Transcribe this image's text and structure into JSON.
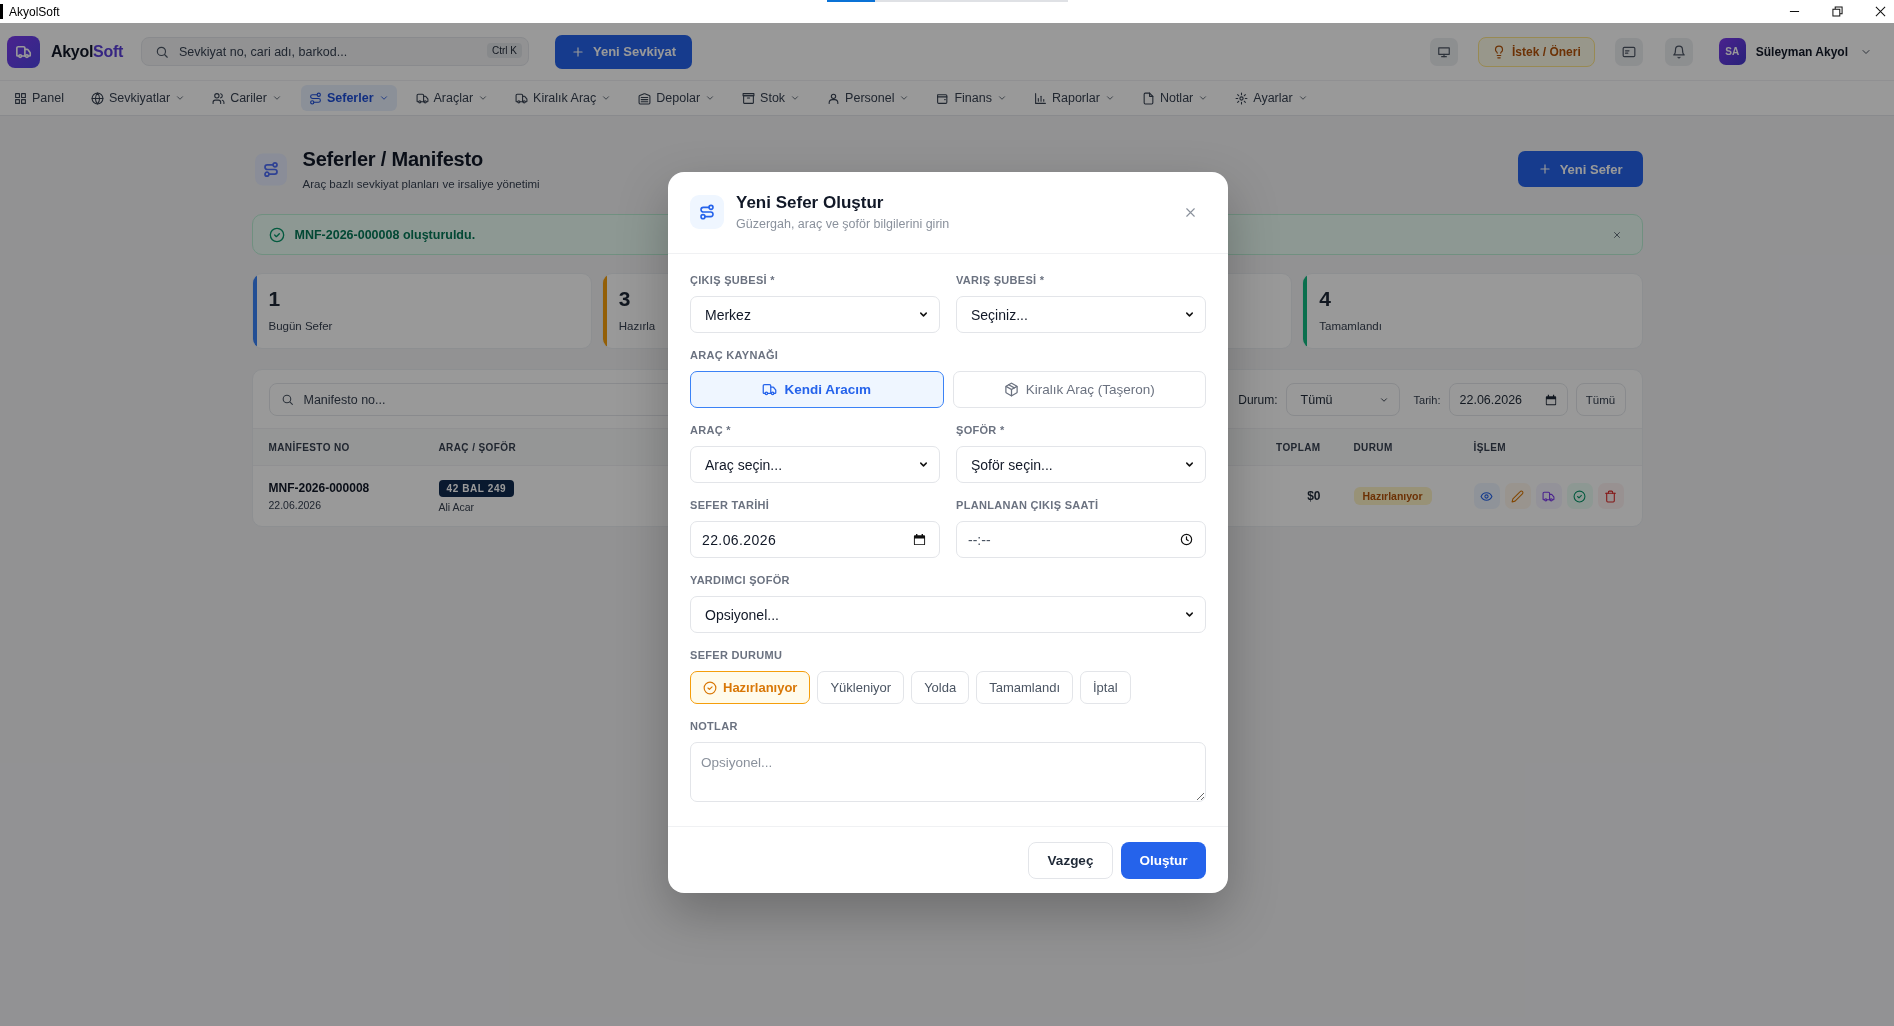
{
  "window": {
    "title": "AkyolSoft",
    "loading": {
      "level": 0.2
    }
  },
  "header": {
    "brand": [
      "Akyol",
      "Soft"
    ],
    "search": {
      "placeholder": "Sevkiyat no, cari adı, barkod...",
      "shortcut": "Ctrl K"
    },
    "new_button": "Yeni Sevkiyat",
    "suggestion_button": "İstek / Öneri",
    "user": {
      "initials": "SA",
      "name": "Süleyman Akyol"
    }
  },
  "nav": [
    {
      "label": "Panel",
      "selected": false,
      "dropdown": false
    },
    {
      "label": "Sevkiyatlar",
      "selected": false,
      "dropdown": true
    },
    {
      "label": "Cariler",
      "selected": false,
      "dropdown": true
    },
    {
      "label": "Seferler",
      "selected": true,
      "dropdown": true
    },
    {
      "label": "Araçlar",
      "selected": false,
      "dropdown": true
    },
    {
      "label": "Kiralık Araç",
      "selected": false,
      "dropdown": true
    },
    {
      "label": "Depolar",
      "selected": false,
      "dropdown": true
    },
    {
      "label": "Stok",
      "selected": false,
      "dropdown": true
    },
    {
      "label": "Personel",
      "selected": false,
      "dropdown": true
    },
    {
      "label": "Finans",
      "selected": false,
      "dropdown": true
    },
    {
      "label": "Raporlar",
      "selected": false,
      "dropdown": true
    },
    {
      "label": "Notlar",
      "selected": false,
      "dropdown": true
    },
    {
      "label": "Ayarlar",
      "selected": false,
      "dropdown": true
    }
  ],
  "page": {
    "title": "Seferler / Manifesto",
    "subtitle": "Araç bazlı sevkiyat planları ve irsaliye yönetimi",
    "new_button": "Yeni Sefer"
  },
  "alert": {
    "message": "MNF-2026-000008 oluşturuldu."
  },
  "stats": [
    {
      "value": "1",
      "label": "Bugün Sefer",
      "color": "#234e94"
    },
    {
      "value": "3",
      "label": "Hazırla",
      "color": "#935f07"
    },
    {
      "value": "4",
      "label": "Tamamlandı",
      "color": "#0a6f4d"
    }
  ],
  "filters": {
    "search_placeholder": "Manifesto no...",
    "status_label": "Durum:",
    "status_value": "Tümü",
    "date_label": "Tarih:",
    "date_value": "22.06.2026",
    "all_button": "Tümü"
  },
  "table": {
    "columns": [
      "MANİFESTO NO",
      "ARAÇ / ŞOFÖR",
      "TOPLAM",
      "DURUM",
      "İŞLEM"
    ],
    "rows": [
      {
        "manifest_no": "MNF-2026-000008",
        "date": "22.06.2026",
        "plate": "42 BAL 249",
        "driver": "Ali Acar",
        "total": "$0",
        "status": "Hazırlanıyor"
      }
    ]
  },
  "modal": {
    "title": "Yeni Sefer Oluştur",
    "subtitle": "Güzergah, araç ve şoför bilgilerini girin",
    "origin": {
      "label": "ÇIKIŞ ŞUBESİ *",
      "value": "Merkez"
    },
    "destination": {
      "label": "VARIŞ ŞUBESİ *",
      "value": "Seçiniz..."
    },
    "vehicle_source": {
      "label": "ARAÇ KAYNAĞI",
      "options": [
        {
          "label": "Kendi Aracım",
          "selected": true
        },
        {
          "label": "Kiralık Araç (Taşeron)",
          "selected": false
        }
      ]
    },
    "vehicle": {
      "label": "ARAÇ *",
      "value": "Araç seçin..."
    },
    "driver": {
      "label": "ŞOFÖR *",
      "value": "Şoför seçin..."
    },
    "date": {
      "label": "SEFER TARİHİ",
      "value": "22.06.2026"
    },
    "departure_time": {
      "label": "PLANLANAN ÇIKIŞ SAATİ",
      "placeholder": "--:--"
    },
    "assistant_driver": {
      "label": "YARDIMCI ŞOFÖR",
      "value": "Opsiyonel..."
    },
    "status": {
      "label": "SEFER DURUMU",
      "options": [
        {
          "label": "Hazırlanıyor",
          "selected": true
        },
        {
          "label": "Yükleniyor",
          "selected": false
        },
        {
          "label": "Yolda",
          "selected": false
        },
        {
          "label": "Tamamlandı",
          "selected": false
        },
        {
          "label": "İptal",
          "selected": false
        }
      ]
    },
    "notes": {
      "label": "NOTLAR",
      "placeholder": "Opsiyonel..."
    },
    "buttons": [
      {
        "label": "Vazgeç",
        "kind": "secondary"
      },
      {
        "label": "Oluştur",
        "kind": "primary"
      }
    ]
  }
}
